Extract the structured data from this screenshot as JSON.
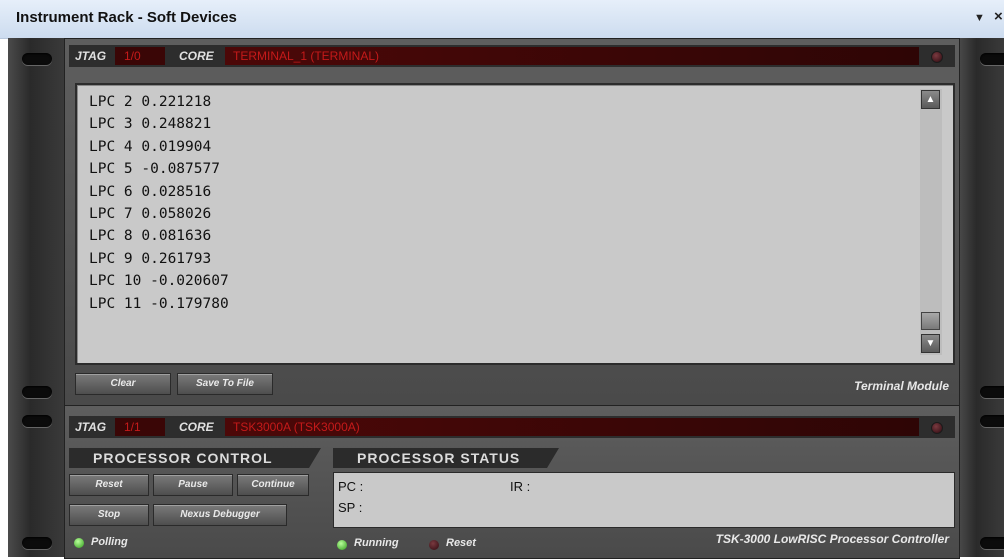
{
  "window": {
    "title": "Instrument Rack - Soft Devices",
    "pin_glyph": "▼",
    "close_glyph": "×"
  },
  "terminal_module": {
    "jtag_label": "JTAG",
    "jtag_value": "1/0",
    "core_label": "CORE",
    "core_value": "TERMINAL_1 (TERMINAL)",
    "lines": [
      "LPC 2 0.221218",
      "LPC 3 0.248821",
      "LPC 4 0.019904",
      "LPC 5 -0.087577",
      "LPC 6 0.028516",
      "LPC 7 0.058026",
      "LPC 8 0.081636",
      "LPC 9 0.261793",
      "LPC 10 -0.020607",
      "LPC 11 -0.179780"
    ],
    "scroll_up_glyph": "▲",
    "scroll_down_glyph": "▼",
    "clear_label": "Clear",
    "save_label": "Save To File",
    "module_name": "Terminal Module"
  },
  "processor_module": {
    "jtag_label": "JTAG",
    "jtag_value": "1/1",
    "core_label": "CORE",
    "core_value": "TSK3000A (TSK3000A)",
    "control_title": "PROCESSOR CONTROL",
    "status_title": "PROCESSOR STATUS",
    "buttons": {
      "reset": "Reset",
      "pause": "Pause",
      "continue": "Continue",
      "stop": "Stop",
      "nexus": "Nexus Debugger"
    },
    "pc_label": "PC :",
    "ir_label": "IR :",
    "sp_label": "SP :",
    "polling_label": "Polling",
    "running_label": "Running",
    "reset_label": "Reset",
    "module_name": "TSK-3000 LowRISC Processor Controller"
  },
  "colors": {
    "accent_red": "#c51a1a",
    "led_green": "#3ec11f",
    "panel_gray": "#c9c9c9"
  }
}
